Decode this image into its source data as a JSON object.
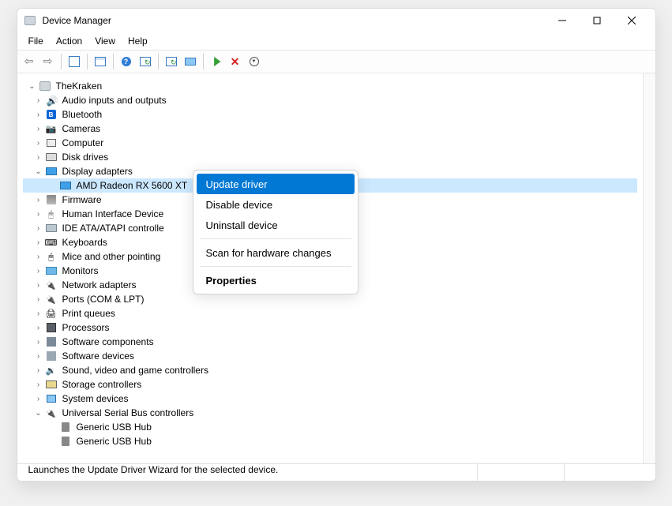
{
  "window": {
    "title": "Device Manager"
  },
  "menubar": {
    "items": [
      "File",
      "Action",
      "View",
      "Help"
    ]
  },
  "toolbar": {
    "back": "Back",
    "forward": "Forward",
    "show_props": "Show/Hide Console Tree",
    "properties": "Properties",
    "help": "Help",
    "scan": "Scan for hardware changes",
    "update": "Update Device Driver",
    "monitor": "Show hidden devices",
    "enable": "Enable Device",
    "uninstall": "Uninstall Device",
    "down": "Options"
  },
  "tree": {
    "root": "TheKraken",
    "categories": [
      {
        "label": "Audio inputs and outputs",
        "icon": "dev-audio",
        "expanded": false
      },
      {
        "label": "Bluetooth",
        "icon": "dev-bt",
        "expanded": false
      },
      {
        "label": "Cameras",
        "icon": "dev-cam",
        "expanded": false
      },
      {
        "label": "Computer",
        "icon": "dev-pc",
        "expanded": false
      },
      {
        "label": "Disk drives",
        "icon": "dev-disk",
        "expanded": false
      },
      {
        "label": "Display adapters",
        "icon": "dev-display",
        "expanded": true,
        "children": [
          {
            "label": "AMD Radeon RX 5600 XT",
            "icon": "dev-display",
            "selected": true
          }
        ]
      },
      {
        "label": "Firmware",
        "icon": "dev-fw",
        "expanded": false
      },
      {
        "label": "Human Interface Devices",
        "icon": "dev-hid",
        "expanded": false,
        "truncated": "Human Interface Device"
      },
      {
        "label": "IDE ATA/ATAPI controllers",
        "icon": "dev-ata",
        "expanded": false,
        "truncated": "IDE ATA/ATAPI controlle"
      },
      {
        "label": "Keyboards",
        "icon": "dev-kb",
        "expanded": false
      },
      {
        "label": "Mice and other pointing devices",
        "icon": "dev-mouse",
        "expanded": false,
        "truncated": "Mice and other pointing"
      },
      {
        "label": "Monitors",
        "icon": "dev-mon",
        "expanded": false
      },
      {
        "label": "Network adapters",
        "icon": "dev-net",
        "expanded": false
      },
      {
        "label": "Ports (COM & LPT)",
        "icon": "dev-port",
        "expanded": false
      },
      {
        "label": "Print queues",
        "icon": "dev-print",
        "expanded": false
      },
      {
        "label": "Processors",
        "icon": "dev-cpu",
        "expanded": false
      },
      {
        "label": "Software components",
        "icon": "dev-swc",
        "expanded": false
      },
      {
        "label": "Software devices",
        "icon": "dev-swd",
        "expanded": false
      },
      {
        "label": "Sound, video and game controllers",
        "icon": "dev-svc",
        "expanded": false
      },
      {
        "label": "Storage controllers",
        "icon": "dev-stor",
        "expanded": false
      },
      {
        "label": "System devices",
        "icon": "dev-sys",
        "expanded": false
      },
      {
        "label": "Universal Serial Bus controllers",
        "icon": "dev-usb",
        "expanded": true,
        "children": [
          {
            "label": "Generic USB Hub",
            "icon": "dev-usbh"
          },
          {
            "label": "Generic USB Hub",
            "icon": "dev-usbh"
          }
        ]
      }
    ]
  },
  "context_menu": {
    "items": [
      {
        "label": "Update driver",
        "highlight": true
      },
      {
        "label": "Disable device"
      },
      {
        "label": "Uninstall device"
      },
      {
        "sep": true
      },
      {
        "label": "Scan for hardware changes"
      },
      {
        "sep": true
      },
      {
        "label": "Properties",
        "bold": true
      }
    ]
  },
  "statusbar": {
    "text": "Launches the Update Driver Wizard for the selected device."
  }
}
